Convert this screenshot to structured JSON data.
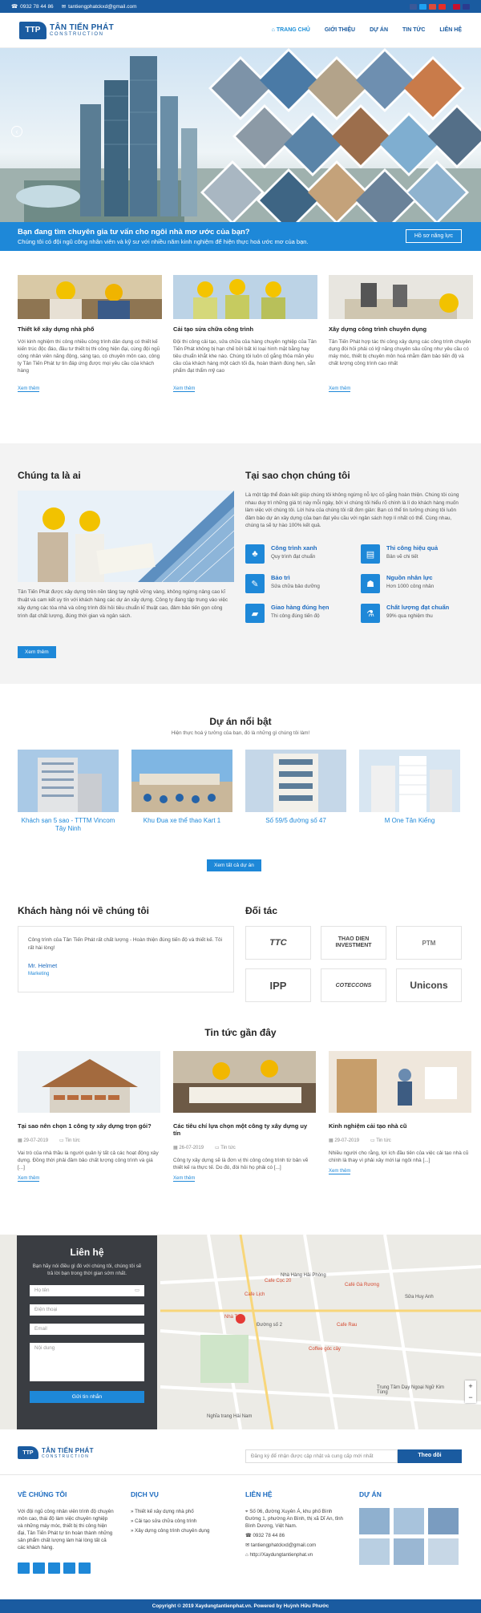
{
  "topbar": {
    "phone": "0932 78 44 86",
    "email": "tantiengphatckxd@gmail.com"
  },
  "brand": {
    "name": "TÂN TIẾN PHÁT",
    "sub": "CONSTRUCTION",
    "mark": "TTP"
  },
  "nav": [
    "TRANG CHỦ",
    "GIỚI THIỆU",
    "DỰ ÁN",
    "TIN TỨC",
    "LIÊN HỆ"
  ],
  "banner": {
    "title": "Bạn đang tìm chuyên gia tư vấn cho ngôi nhà mơ ước của bạn?",
    "subtitle": "Chúng tôi có đội ngũ công nhân viên và kỹ sư với nhiều năm kinh nghiệm để hiện thực hoá ước mơ của bạn.",
    "button": "Hồ sơ năng lực"
  },
  "services": [
    {
      "title": "Thiết kế xây dựng nhà phố",
      "desc": "Với kinh nghiệm thi công nhiều công trình dân dụng có thiết kế kiến trúc độc đáo, đầu tư thiết bị thi công hiện đại, cùng đội ngũ công nhân viên năng động, sáng tạo, có chuyên môn cao, công ty Tân Tiến Phát tự tin đáp ứng được mọi yêu cầu của khách hàng",
      "more": "Xem thêm"
    },
    {
      "title": "Cải tạo sửa chữa công trình",
      "desc": "Đội thi công cải tạo, sửa chữa của hàng chuyên nghiệp của Tân Tiến Phát không bị hạn chế bởi bất kì loại hình mặt bằng hay tiêu chuẩn khắt khe nào. Chúng tôi luôn cố gắng thỏa mãn yêu cầu của khách hàng một cách tối đa, hoàn thành đúng hẹn, sẵn phẩm đạt thẩm mỹ cao",
      "more": "Xem thêm"
    },
    {
      "title": "Xây dựng công trình chuyên dụng",
      "desc": "Tân Tiến Phát hợp tác thi công xây dựng các công trình chuyên dụng đòi hỏi phải có kỹ năng chuyên sâu cũng như yêu cầu có máy móc, thiết bị chuyên môn hoá nhằm đảm bảo tiến độ và chất lượng công trình cao nhất",
      "more": "Xem thêm"
    }
  ],
  "about": {
    "title": "Chúng ta là ai",
    "desc": "Tân Tiến Phát được xây dựng trên nền tảng tay nghề vững vàng, không ngừng nâng cao kĩ thuật và cam kết uy tín với khách hàng các dự án xây dựng. Công ty đang tập trung vào việc xây dựng các tòa nhà và công trình đòi hỏi tiêu chuẩn kĩ thuật cao, đảm bảo tiến gọn công trình đạt chất lượng, đúng thời gian và ngân sách.",
    "button": "Xem thêm"
  },
  "why": {
    "title": "Tại sao chọn chúng tôi",
    "desc": "Là một tập thể đoàn kết giúp chúng tôi không ngừng nỗ lực cố gắng hoàn thiện. Chúng tôi cùng nhau duy trì những giá trị này mỗi ngày, bởi vì chúng tôi hiểu rõ chính là lí do khách hàng muốn làm việc với chúng tôi. Lời hứa của chúng tôi rất đơn giản: Bạn có thể tin tưởng chúng tôi luôn đảm bảo dự án xây dựng của bạn đạt yêu cầu với ngân sách hợp lí nhất có thể. Cùng nhau, chúng ta sẽ tự hào 100% kết quả.",
    "features": [
      {
        "title": "Công trình xanh",
        "desc": "Quy trình đạt chuẩn",
        "icon": "tree-icon"
      },
      {
        "title": "Thi công hiệu quả",
        "desc": "Bản vẽ chi tiết",
        "icon": "blueprint-icon"
      },
      {
        "title": "Bảo trì",
        "desc": "Sửa chữa bảo dưỡng",
        "icon": "wrench-icon"
      },
      {
        "title": "Nguồn nhân lực",
        "desc": "Hơn 1000 công nhân",
        "icon": "workers-icon"
      },
      {
        "title": "Giao hàng đúng hẹn",
        "desc": "Thi công đúng tiến độ",
        "icon": "truck-icon"
      },
      {
        "title": "Chất lượng đạt chuẩn",
        "desc": "99% qua nghiệm thu",
        "icon": "flask-icon"
      }
    ]
  },
  "projects": {
    "title": "Dự án nổi bật",
    "subtitle": "Hiện thực hoá ý tưởng của bạn, đó là những gì chúng tôi làm!",
    "items": [
      "Khách sạn 5 sao - TTTM Vincom Tây Ninh",
      "Khu Đua xe thể thao Kart 1",
      "Số 59/5 đường số 47",
      "M One Tân Kiểng"
    ],
    "button": "Xem tất cả dự án"
  },
  "testimonial": {
    "title": "Khách hàng nói về chúng tôi",
    "quote": "Công trình của Tân Tiến Phát rất chất lượng - Hoàn thiện đúng tiến độ và thiết kế. Tôi rất hài lòng!",
    "name": "Mr. Helmet",
    "role": "Marketing"
  },
  "partners": {
    "title": "Đối tác",
    "items": [
      "TTC",
      "THAO DIEN INVESTMENT",
      "PTM",
      "IPP",
      "COTECCONS",
      "Unicons"
    ]
  },
  "news": {
    "title": "Tin tức gần đây",
    "items": [
      {
        "title": "Tại sao nên chọn 1 công ty xây dựng trọn gói?",
        "date": "29-07-2019",
        "cat": "Tin tức",
        "desc": "Vai trò của nhà thầu là người quản lý tất cả các hoạt động xây dựng. Đồng thời phải đảm bảo chất lượng công trình và giá [...]",
        "more": "Xem thêm"
      },
      {
        "title": "Các tiêu chí lựa chọn một công ty xây dựng uy tín",
        "date": "26-07-2019",
        "cat": "Tin tức",
        "desc": "Công ty xây dựng sẽ là đơn vị thi công công trình từ bản vẽ thiết kế ra thực tế. Do đó, đòi hỏi họ phải có [...]",
        "more": "Xem thêm"
      },
      {
        "title": "Kinh nghiệm cải tạo nhà cũ",
        "date": "29-07-2019",
        "cat": "Tin tức",
        "desc": "Nhiều người cho rằng, lợi ích đầu tiên của việc cải tạo nhà cũ chính là thay vì phải xây mới lại ngôi nhà [...]",
        "more": "Xem thêm"
      }
    ]
  },
  "contact": {
    "title": "Liên hệ",
    "subtitle": "Bạn hãy nói điều gì đó với chúng tôi, chúng tôi sẽ trả lời bạn trong thời gian sớm nhất.",
    "fields": [
      "Họ tên",
      "Điện thoại",
      "Email",
      "Nội dung"
    ],
    "button": "Gửi tin nhắn"
  },
  "map": {
    "labels": [
      "Cafe Lịch",
      "Cafe Cọc 20",
      "Cafe Rau",
      "Café Gà Rương",
      "Nhà Trọ",
      "Nhà Hàng Hải Phòng",
      "Sửa Huy Anh",
      "Coffee góc cây",
      "Trung Tâm Dạy Ngoại Ngữ Kim Tùng",
      "Nghĩa trang Hải Nam",
      "Đường số 2"
    ],
    "zoom_in": "+",
    "zoom_out": "−"
  },
  "newsletter": {
    "placeholder": "Đăng ký để nhận được cập nhật và cung cấp mới nhất",
    "button": "Theo dõi"
  },
  "footer": {
    "about_title": "VỀ CHÚNG TÔI",
    "about": "Với đội ngũ công nhân viên trình độ chuyên môn cao, thái độ làm việc chuyên nghiệp và những máy móc, thiết bị thi công hiện đại, Tân Tiến Phát tự tin hoàn thành những sản phẩm chất lượng làm hài lòng tất cả các khách hàng.",
    "service_title": "DỊCH VỤ",
    "services": [
      "Thiết kế xây dựng nhà phố",
      "Cải tạo sửa chữa công trình",
      "Xây dựng công trình chuyên dụng"
    ],
    "contact_title": "LIÊN HỆ",
    "address": "Số 06, đường Xuyên Á, khu phố Bình Đường 1, phường An Bình, thị xã Dĩ An, tỉnh Bình Dương, Việt Nam.",
    "phone": "0932 78 44 86",
    "email": "tantiengphatckxd@gmail.com",
    "web": "http://Xaydungtantienphat.vn",
    "projects_title": "DỰ ÁN",
    "copyright": "Copyright © 2019 Xaydungtantienphat.vn. Powered by Huỳnh Hữu Phước"
  }
}
